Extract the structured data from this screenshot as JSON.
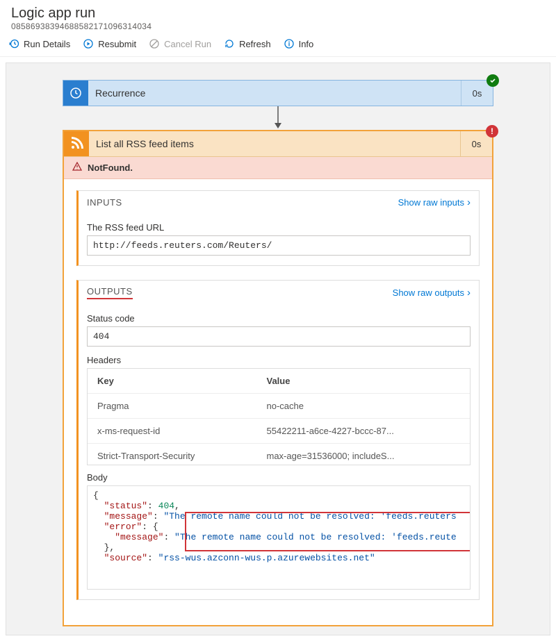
{
  "header": {
    "title": "Logic app run",
    "run_id": "08586938394688582171096314034"
  },
  "toolbar": {
    "run_details": "Run Details",
    "resubmit": "Resubmit",
    "cancel_run": "Cancel Run",
    "refresh": "Refresh",
    "info": "Info"
  },
  "step1": {
    "label": "Recurrence",
    "duration": "0s"
  },
  "card": {
    "title": "List all RSS feed items",
    "duration": "0s",
    "error_text": "NotFound."
  },
  "inputs": {
    "title": "INPUTS",
    "raw_link": "Show raw inputs",
    "url_label": "The RSS feed URL",
    "url_value": "http://feeds.reuters.com/Reuters/"
  },
  "outputs": {
    "title": "OUTPUTS",
    "raw_link": "Show raw outputs",
    "status_label": "Status code",
    "status_value": "404",
    "headers_label": "Headers",
    "key_header": "Key",
    "value_header": "Value",
    "headers": [
      {
        "k": "Pragma",
        "v": "no-cache"
      },
      {
        "k": "x-ms-request-id",
        "v": "55422211-a6ce-4227-bccc-87..."
      },
      {
        "k": "Strict-Transport-Security",
        "v": "max-age=31536000; includeS..."
      }
    ],
    "body_label": "Body",
    "body": {
      "status": 404,
      "message": "The remote name could not be resolved: 'feeds.reuters",
      "error_key": "error",
      "inner_message": "The remote name could not be resolved: 'feeds.reute",
      "source": "rss-wus.azconn-wus.p.azurewebsites.net"
    }
  }
}
